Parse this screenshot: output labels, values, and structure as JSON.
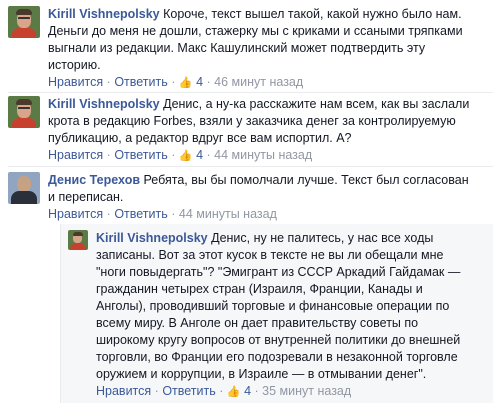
{
  "comments": [
    {
      "author": "Kirill Vishnepolsky",
      "text": "Короче, текст вышел такой, какой нужно было нам. Деньги до меня не дошли, стажерку мы с криками и ссаными тряпками выгнали из редакции. Макс Кашулинский может подтвердить эту историю.",
      "like": "Нравится",
      "reply": "Ответить",
      "like_count": "4",
      "time": "46 минут назад"
    },
    {
      "author": "Kirill Vishnepolsky",
      "text": "Денис, а ну-ка расскажите нам всем, как вы заслали крота в редакцию Forbes, взяли у заказчика денег за контролируемую публикацию, а редактор вдруг все вам испортил. А?",
      "like": "Нравится",
      "reply": "Ответить",
      "like_count": "4",
      "time": "44 минуты назад"
    },
    {
      "author": "Денис Терехов",
      "text": "Ребята, вы бы помолчали лучше. Текст был согласован и переписан.",
      "like": "Нравится",
      "reply": "Ответить",
      "time": "44 минуты назад"
    },
    {
      "author": "Kirill Vishnepolsky",
      "text": "Денис, ну не палитесь, у нас все ходы записаны. Вот за этот кусок в тексте не вы ли обещали мне \"ноги повыдергать\"? \"Эмигрант из СССР Аркадий Гайдамак — гражданин четырех стран (Израиля, Франции, Канады и Анголы), проводивший торговые и финансовые операции по всему миру. В Анголе он дает правительству советы по широкому кругу вопросов от внутренней политики до внешней торговли, во Франции его подозревали в незаконной торговле оружием и коррупции, в Израиле — в отмывании денег\".",
      "like": "Нравится",
      "reply": "Ответить",
      "like_count": "4",
      "time": "35 минут назад"
    }
  ],
  "icons": {
    "like": "thumbs-up-icon"
  },
  "colors": {
    "link": "#3b5998",
    "meta": "#9197a3",
    "text": "#141823"
  }
}
